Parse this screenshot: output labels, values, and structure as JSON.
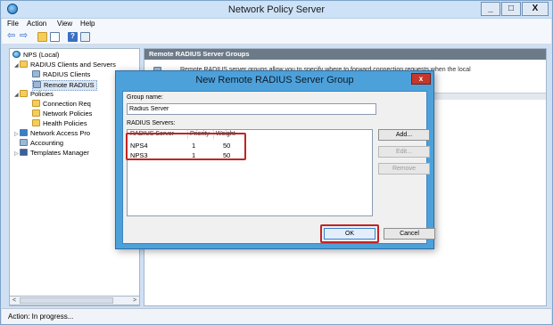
{
  "window": {
    "title": "Network Policy Server",
    "controls": {
      "minimize": "_",
      "maximize": "□",
      "close": "X"
    }
  },
  "menu": [
    "File",
    "Action",
    "View",
    "Help"
  ],
  "toolbar": {
    "icons": [
      "back-arrow-icon",
      "forward-arrow-icon",
      "folder-up-icon",
      "show-hide-tree-icon",
      "help-icon",
      "properties-icon"
    ]
  },
  "tree": {
    "items": [
      {
        "label": "NPS (Local)",
        "icon": "globe-icon"
      },
      {
        "label": "RADIUS Clients and Servers",
        "icon": "folder-icon"
      },
      {
        "label": "RADIUS Clients",
        "icon": "server-icon"
      },
      {
        "label": "Remote RADIUS",
        "icon": "server-icon"
      },
      {
        "label": "Policies",
        "icon": "folder-icon"
      },
      {
        "label": "Connection Req",
        "icon": "folder-icon"
      },
      {
        "label": "Network Policies",
        "icon": "folder-icon"
      },
      {
        "label": "Health Policies",
        "icon": "folder-icon"
      },
      {
        "label": "Network Access Pro",
        "icon": "network-icon"
      },
      {
        "label": "Accounting",
        "icon": "accounting-icon"
      },
      {
        "label": "Templates Manager",
        "icon": "templates-icon"
      }
    ]
  },
  "right_pane": {
    "header": "Remote RADIUS Server Groups",
    "description": "Remote RADIUS server groups allow you to specify where to forward connection requests when the local"
  },
  "status": "Action:  In progress...",
  "dialog": {
    "title": "New Remote RADIUS Server Group",
    "close": "x",
    "group_name_label": "Group name:",
    "group_name_value": "Radius Server",
    "servers_label": "RADIUS Servers:",
    "columns": [
      "RADIUS Server",
      "Priority",
      "Weight"
    ],
    "rows": [
      {
        "server": "NPS4",
        "priority": "1",
        "weight": "50"
      },
      {
        "server": "NPS3",
        "priority": "1",
        "weight": "50"
      }
    ],
    "buttons": {
      "add": "Add...",
      "edit": "Edit...",
      "remove": "Remove",
      "ok": "OK",
      "cancel": "Cancel"
    },
    "highlight_color": "#c22424"
  }
}
